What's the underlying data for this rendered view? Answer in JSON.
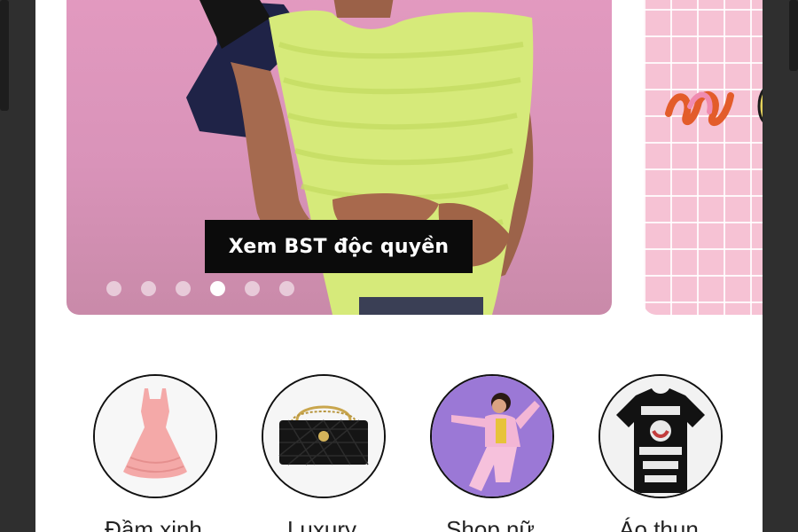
{
  "banner": {
    "cta_label": "Xem BST độc quyền",
    "slide_count": 6,
    "active_slide": 4
  },
  "categories": [
    {
      "label": "Đầm xinh",
      "icon": "pink-dress"
    },
    {
      "label": "Luxury",
      "icon": "black-quilted-handbag"
    },
    {
      "label": "Shop nữ",
      "icon": "woman-in-pink-outfit"
    },
    {
      "label": "Áo thun",
      "icon": "black-graphic-tshirt"
    }
  ],
  "colors": {
    "banner_bg": "#e39ac0",
    "cta_bg": "#0b0b0b",
    "cta_text": "#ffffff",
    "next_banner_bg": "#f6c2d4",
    "frame": "#2f2f2f"
  }
}
